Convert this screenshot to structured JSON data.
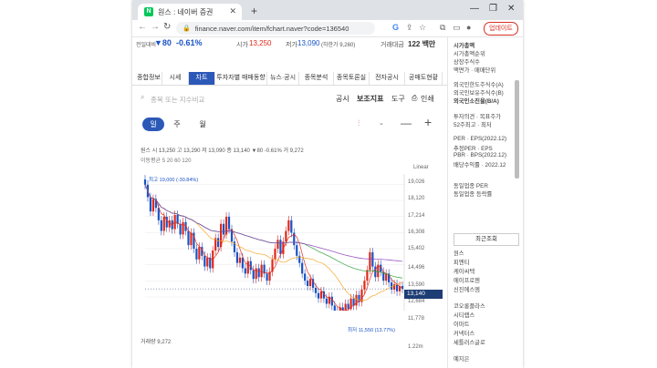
{
  "browser": {
    "tab_title": "원스 : 네이버 증권",
    "favicon_letter": "N",
    "url": "finance.naver.com/item/fchart.naver?code=136540",
    "update_label": "업데이트"
  },
  "stock": {
    "prev_label": "전일대비",
    "change": "▼80",
    "change_pct": "-0.61%",
    "high_label": "시가",
    "high_value": "13,250",
    "low_label": "저가",
    "low_value": "13,090",
    "low_limit": "(하한가 9,260)",
    "amount_label": "거래대금",
    "amount_value": "122 백만"
  },
  "menu": [
    "종합정보",
    "시세",
    "차트",
    "투자자별 매매동향",
    "뉴스·공시",
    "종목분석",
    "종목토론실",
    "전자공시",
    "공매도현황"
  ],
  "menu_active": 2,
  "chart_tools": {
    "search_placeholder": "종목 또는 지수비교",
    "notice": "공시",
    "indicator": "보조지표",
    "tools": "도구",
    "print": "인쇄"
  },
  "periods": [
    "일",
    "주",
    "월"
  ],
  "period_active": 0,
  "info": {
    "ohlc": "원스  시 13,250  고 13,290  저 13,090  종 13,140  ▼80 -0.61%  거 9,272",
    "ma": "이동평균  5  20  60  120",
    "scale": "Linear",
    "max": "최고 19,000 (-30.84%)",
    "min": "최저 11,550 (13.77%)",
    "volume": "거래량 9,272",
    "volume_axis": "1.22m",
    "current_price": "13,140"
  },
  "y_ticks": [
    "19,026",
    "18,120",
    "17,214",
    "16,308",
    "15,402",
    "14,496",
    "13,590",
    "12,684",
    "11,778"
  ],
  "right_panel": {
    "lines": [
      "시가총액",
      "시가총액순위",
      "상장주식수",
      "액면가 · 매매단위",
      "외국인한도주식수(A)",
      "외국인보유주식수(B)",
      "외국인소진율(B/A)",
      "투자의견 · 목표주가",
      "52주최고 · 최저",
      "PER · EPS(2022.12)",
      "추정PER · EPS",
      "PBR · BPS(2022.12)",
      "배당수익률 · 2022.12",
      "동일업종 PER",
      "동일업종 등락률"
    ],
    "recent_title": "최근조회",
    "recent": [
      "원스",
      "피엔티",
      "케이씨텍",
      "에이프로젠",
      "신진에스엠",
      "코오롱플라스",
      "시티랩스",
      "이마트",
      "커넥터스",
      "세틀러스글로",
      "예지은"
    ]
  },
  "colors": {
    "accent": "#2c58b8",
    "up": "#e0281a",
    "down": "#1a53c6"
  },
  "chart_data": {
    "type": "candlestick",
    "title": "원스",
    "y_ticks": [
      19026,
      18120,
      17214,
      16308,
      15402,
      14496,
      13590,
      12684,
      11778
    ],
    "ylim": [
      11300,
      19300
    ],
    "close": [
      19000,
      18300,
      17500,
      18200,
      17700,
      17000,
      16400,
      17200,
      16600,
      17000,
      16500,
      17300,
      16800,
      16200,
      16900,
      16400,
      15600,
      16300,
      15400,
      14800,
      15500,
      15000,
      14400,
      14900,
      14300,
      15300,
      16000,
      15500,
      16800,
      16200,
      17200,
      16500,
      15800,
      15200,
      14600,
      14900,
      14300,
      14000,
      14700,
      14200,
      13700,
      14300,
      13800,
      14500,
      14000,
      13600,
      14100,
      14800,
      15400,
      15900,
      15100,
      15800,
      16400,
      17000,
      16300,
      15600,
      15000,
      14600,
      14000,
      13600,
      13300,
      13700,
      13200,
      12900,
      12600,
      13000,
      12600,
      12300,
      12700,
      12200,
      11900,
      11550,
      12100,
      11800,
      12300,
      12000,
      12600,
      12200,
      12800,
      12400,
      13100,
      13600,
      14200,
      15200,
      14400,
      13800,
      14500,
      14100,
      13600,
      14000,
      13500,
      13100,
      13400,
      13000,
      13300,
      13140
    ],
    "max_label": "최고 19,000 (-30.84%)",
    "min_label": "최저 11,550 (13.77%)",
    "moving_averages": [
      5,
      20,
      60,
      120
    ]
  }
}
